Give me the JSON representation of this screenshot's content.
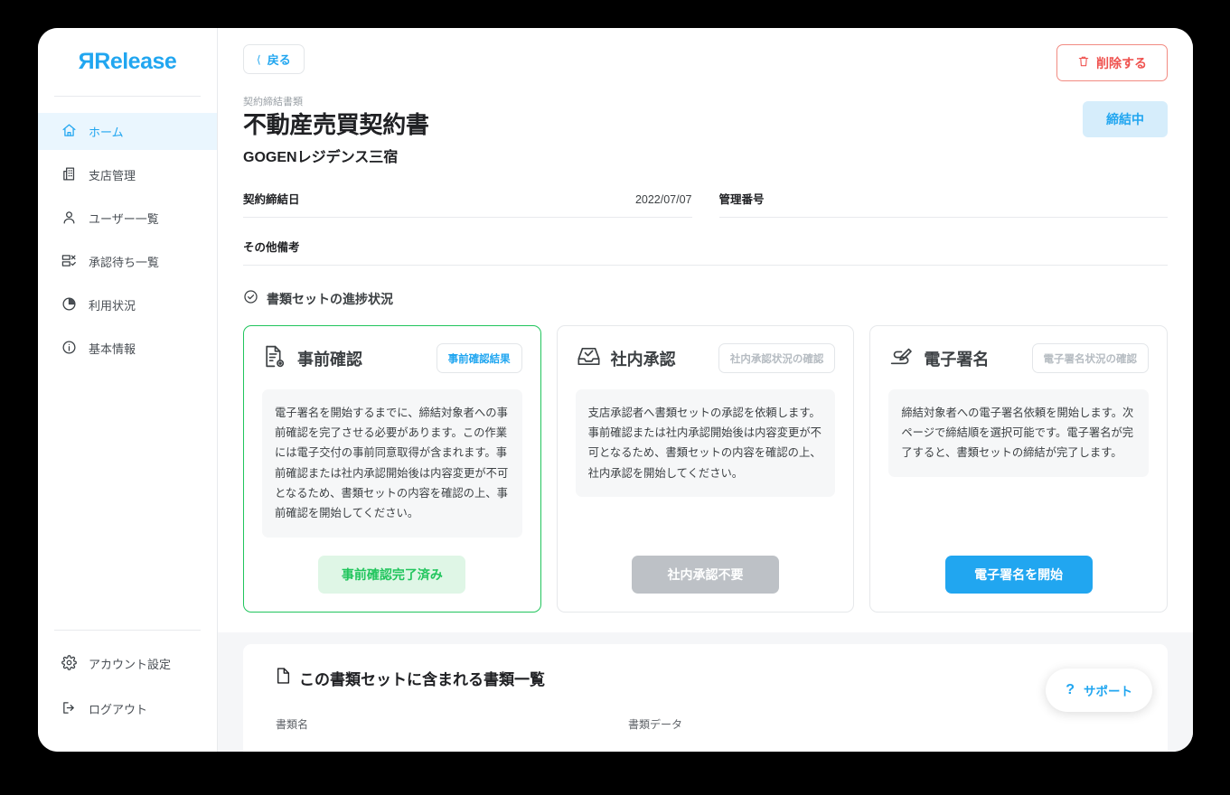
{
  "brand": {
    "name": "Release"
  },
  "sidebar": {
    "main_items": [
      {
        "label": "ホーム",
        "icon": "home-icon",
        "active": true
      },
      {
        "label": "支店管理",
        "icon": "building-icon",
        "active": false
      },
      {
        "label": "ユーザー一覧",
        "icon": "user-icon",
        "active": false
      },
      {
        "label": "承認待ち一覧",
        "icon": "approval-list-icon",
        "active": false
      },
      {
        "label": "利用状況",
        "icon": "pie-chart-icon",
        "active": false
      },
      {
        "label": "基本情報",
        "icon": "info-circle-icon",
        "active": false
      }
    ],
    "bottom_items": [
      {
        "label": "アカウント設定",
        "icon": "gear-icon"
      },
      {
        "label": "ログアウト",
        "icon": "logout-icon"
      }
    ]
  },
  "topbar": {
    "back_label": "戻る",
    "delete_label": "削除する"
  },
  "header": {
    "eyebrow": "契約締結書類",
    "title": "不動産売買契約書",
    "subtitle": "GOGENレジデンス三宿",
    "status_badge": "締結中"
  },
  "meta": {
    "contract_date_label": "契約締結日",
    "contract_date_value": "2022/07/07",
    "management_no_label": "管理番号",
    "management_no_value": "",
    "remarks_label": "その他備考",
    "remarks_value": ""
  },
  "progress_section": {
    "heading": "書類セットの進捗状況"
  },
  "cards": [
    {
      "id": "pre-check",
      "icon": "document-review-icon",
      "title": "事前確認",
      "action_label": "事前確認結果",
      "action_disabled": false,
      "description": "電子署名を開始するまでに、締結対象者への事前確認を完了させる必要があります。この作業には電子交付の事前同意取得が含まれます。事前確認または社内承認開始後は内容変更が不可となるため、書類セットの内容を確認の上、事前確認を開始してください。",
      "cta_label": "事前確認完了済み",
      "cta_style": "done",
      "highlighted": true
    },
    {
      "id": "internal-approval",
      "icon": "inbox-check-icon",
      "title": "社内承認",
      "action_label": "社内承認状況の確認",
      "action_disabled": true,
      "description": "支店承認者へ書類セットの承認を依頼します。事前確認または社内承認開始後は内容変更が不可となるため、書類セットの内容を確認の上、社内承認を開始してください。",
      "cta_label": "社内承認不要",
      "cta_style": "disabled",
      "highlighted": false
    },
    {
      "id": "e-signature",
      "icon": "signature-icon",
      "title": "電子署名",
      "action_label": "電子署名状況の確認",
      "action_disabled": true,
      "description": "締結対象者への電子署名依頼を開始します。次ページで締結順を選択可能です。電子署名が完了すると、書類セットの締結が完了します。",
      "cta_label": "電子署名を開始",
      "cta_style": "primary",
      "highlighted": false
    }
  ],
  "document_panel": {
    "title": "この書類セットに含まれる書類一覧",
    "columns": [
      "書類名",
      "書類データ"
    ]
  },
  "support": {
    "icon": "question-mark-icon",
    "label": "サポート"
  },
  "colors": {
    "accent_blue": "#21a6f0",
    "danger_red": "#ef5350",
    "success_green": "#21c55d",
    "badge_bg": "#d6edfb",
    "page_bg": "#f5f6f8"
  }
}
